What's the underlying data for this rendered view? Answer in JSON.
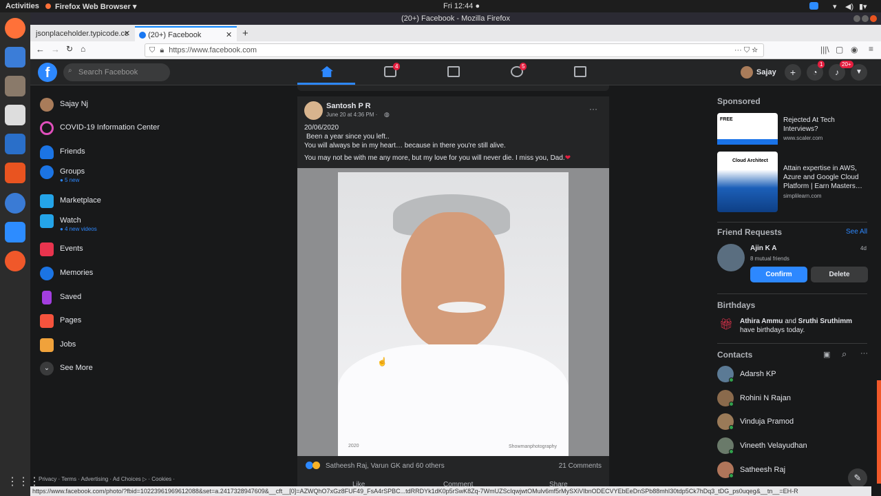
{
  "os": {
    "activities": "Activities",
    "app_menu": "Firefox Web Browser ▾",
    "clock": "Fri 12:44 ●"
  },
  "browser": {
    "window_title": "(20+) Facebook - Mozilla Firefox",
    "tabs": [
      {
        "label": "jsonplaceholder.typicode.cc"
      },
      {
        "label": "(20+) Facebook"
      }
    ],
    "url": "https://www.facebook.com",
    "status_url": "https://www.facebook.com/photo/?fbid=10223961969612088&set=a.2417328947609&__cft__[0]=AZWQhO7xGz8FUF49_FsA4rSPBC...tdRRDYk1dK0p5rSwK8Zq-7WmUZScIqwjwtOMulv6mf5rMySXiVIbnODECVYEbEeDnSPb88mhI30tdp5Ck7hDq3_tDG_ps0uqeg&__tn__=EH-R"
  },
  "fb": {
    "search_placeholder": "Search Facebook",
    "nav_badges": {
      "watch": "4",
      "groups": "5",
      "messenger": "1",
      "notifications": "20+"
    },
    "profile_name": "Sajay",
    "left_nav": [
      {
        "label": "Sajay Nj",
        "sub": ""
      },
      {
        "label": "COVID-19 Information Center",
        "sub": ""
      },
      {
        "label": "Friends",
        "sub": ""
      },
      {
        "label": "Groups",
        "sub": "● 5 new"
      },
      {
        "label": "Marketplace",
        "sub": ""
      },
      {
        "label": "Watch",
        "sub": "● 4 new videos"
      },
      {
        "label": "Events",
        "sub": ""
      },
      {
        "label": "Memories",
        "sub": ""
      },
      {
        "label": "Saved",
        "sub": ""
      },
      {
        "label": "Pages",
        "sub": ""
      },
      {
        "label": "Jobs",
        "sub": ""
      },
      {
        "label": "See More",
        "sub": ""
      }
    ],
    "footer_links": "Privacy · Terms · Advertising · Ad Choices ▷ · Cookies ·",
    "post": {
      "author": "Santosh P R",
      "time": "June 20 at 4:36 PM ·",
      "line1": "20/06/2020",
      "line2": "Been a year since you left..",
      "line3": "You will always be in my heart… because in there you're still alive.",
      "line4": "You may not be with me any more, but my love for you will never die. I miss you, Dad.",
      "photo_year": "2020",
      "photo_credit": "Showmanphotography",
      "reactions_text": "Satheesh Raj, Varun GK and 60 others",
      "comments": "21 Comments",
      "like": "Like",
      "comment": "Comment",
      "share": "Share"
    },
    "sponsored": {
      "title": "Sponsored",
      "ads": [
        {
          "headline": "Rejected At Tech Interviews?",
          "domain": "www.scaler.com",
          "thumb_text": "FREE"
        },
        {
          "headline": "Attain expertise in AWS, Azure and Google Cloud Platform | Earn Masters…",
          "domain": "simplilearn.com",
          "thumb_text": "Cloud Architect"
        }
      ]
    },
    "friend_requests": {
      "title": "Friend Requests",
      "see_all": "See All",
      "name": "Ajin K A",
      "mutual": "8 mutual friends",
      "age": "4d",
      "confirm": "Confirm",
      "delete": "Delete"
    },
    "birthdays": {
      "title": "Birthdays",
      "name1": "Athira Ammu",
      "and": " and ",
      "name2": "Sruthi Sruthimm",
      "rest": "have birthdays today."
    },
    "contacts": {
      "title": "Contacts",
      "list": [
        "Adarsh KP",
        "Rohini N Rajan",
        "Vinduja Pramod",
        "Vineeth Velayudhan",
        "Satheesh Raj"
      ]
    }
  },
  "colors": {
    "fb_blue": "#2d88ff",
    "badge_red": "#e41e3f",
    "online_green": "#31a24c"
  }
}
